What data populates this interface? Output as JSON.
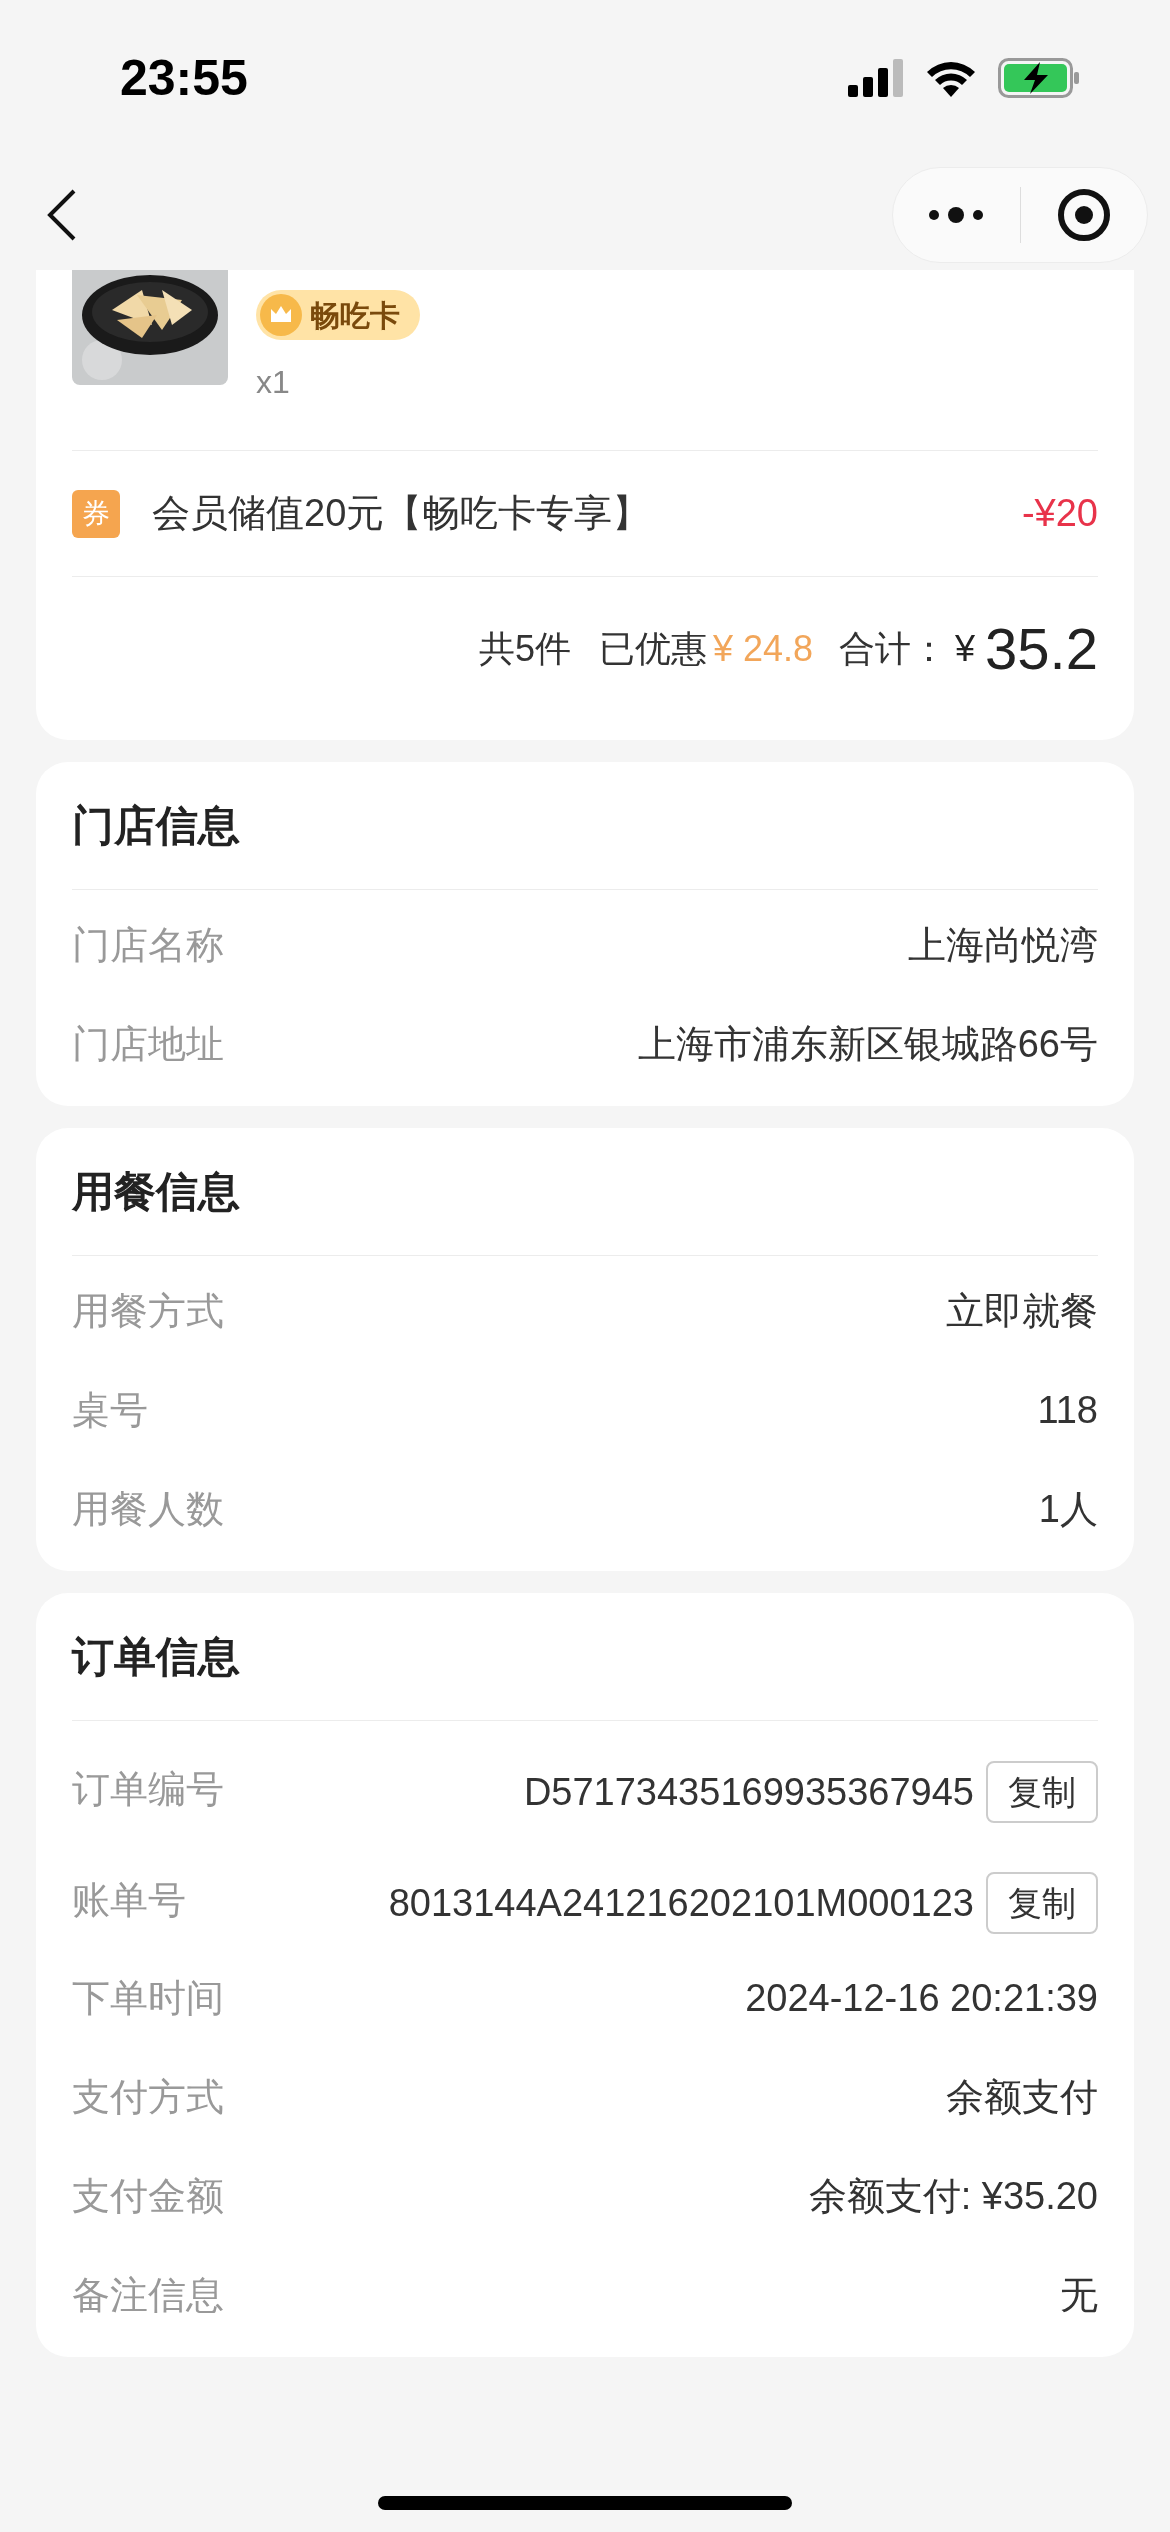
{
  "status_bar": {
    "time": "23:55"
  },
  "product": {
    "badge": "畅吃卡",
    "quantity": "x1"
  },
  "coupon": {
    "tag": "券",
    "name": "会员储值20元【畅吃卡专享】",
    "amount": "-¥20"
  },
  "summary": {
    "count": "共5件",
    "discount_label": "已优惠",
    "discount": "¥ 24.8",
    "total_label": "合计：",
    "currency": "¥",
    "total": "35.2"
  },
  "sections": [
    {
      "title": "门店信息",
      "rows": [
        {
          "label": "门店名称",
          "value": "上海尚悦湾"
        },
        {
          "label": "门店地址",
          "value": "上海市浦东新区银城路66号"
        }
      ]
    },
    {
      "title": "用餐信息",
      "rows": [
        {
          "label": "用餐方式",
          "value": "立即就餐"
        },
        {
          "label": "桌号",
          "value": "118"
        },
        {
          "label": "用餐人数",
          "value": "1人"
        }
      ]
    },
    {
      "title": "订单信息",
      "rows": [
        {
          "label": "订单编号",
          "value": "D57173435169935367945",
          "action": "复制"
        },
        {
          "label": "账单号",
          "value": "8013144A241216202101M000123",
          "action": "复制"
        },
        {
          "label": "下单时间",
          "value": "2024-12-16 20:21:39"
        },
        {
          "label": "支付方式",
          "value": "余额支付"
        },
        {
          "label": "支付金额",
          "value": "余额支付: ¥35.20"
        },
        {
          "label": "备注信息",
          "value": "无"
        }
      ]
    }
  ]
}
